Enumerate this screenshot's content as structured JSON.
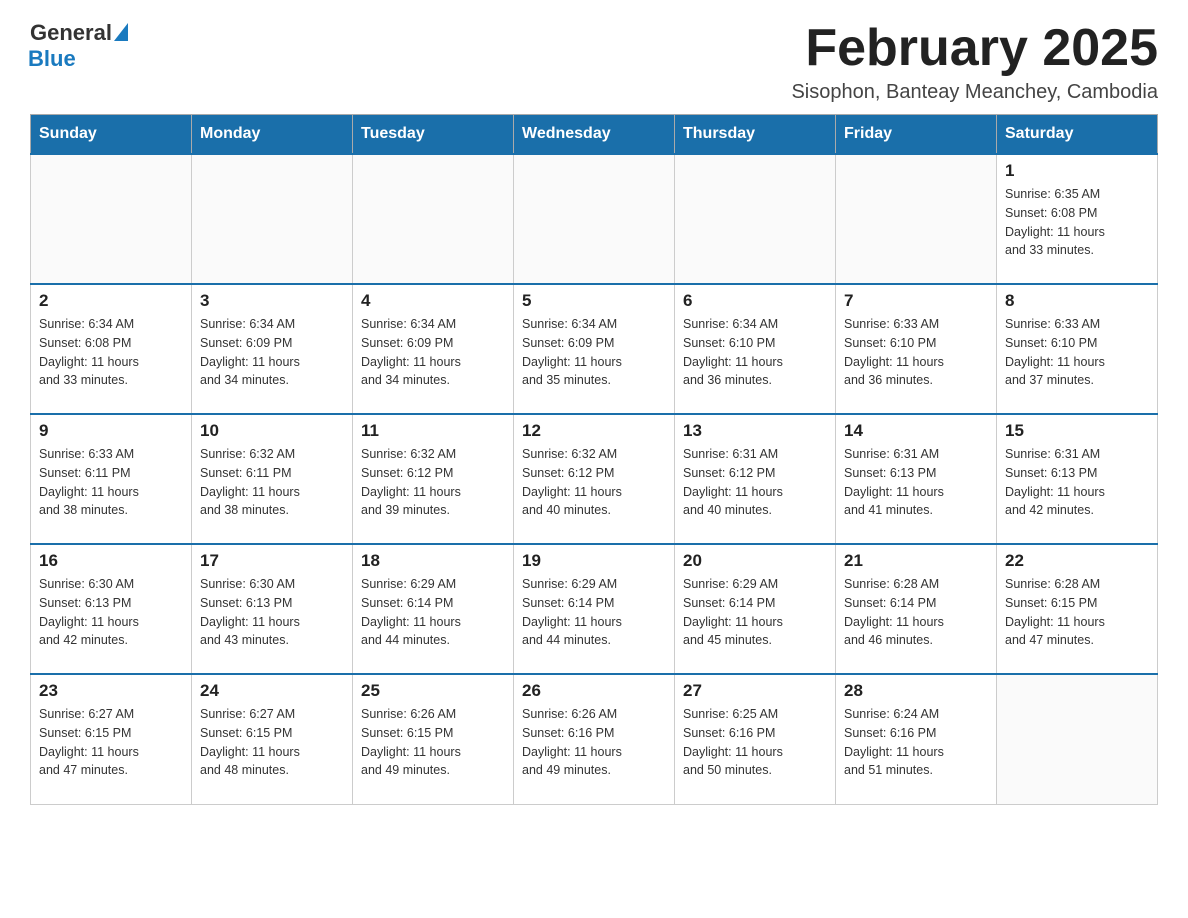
{
  "logo": {
    "general": "General",
    "blue": "Blue"
  },
  "header": {
    "title": "February 2025",
    "subtitle": "Sisophon, Banteay Meanchey, Cambodia"
  },
  "days_of_week": [
    "Sunday",
    "Monday",
    "Tuesday",
    "Wednesday",
    "Thursday",
    "Friday",
    "Saturday"
  ],
  "weeks": [
    [
      {
        "day": "",
        "info": ""
      },
      {
        "day": "",
        "info": ""
      },
      {
        "day": "",
        "info": ""
      },
      {
        "day": "",
        "info": ""
      },
      {
        "day": "",
        "info": ""
      },
      {
        "day": "",
        "info": ""
      },
      {
        "day": "1",
        "info": "Sunrise: 6:35 AM\nSunset: 6:08 PM\nDaylight: 11 hours\nand 33 minutes."
      }
    ],
    [
      {
        "day": "2",
        "info": "Sunrise: 6:34 AM\nSunset: 6:08 PM\nDaylight: 11 hours\nand 33 minutes."
      },
      {
        "day": "3",
        "info": "Sunrise: 6:34 AM\nSunset: 6:09 PM\nDaylight: 11 hours\nand 34 minutes."
      },
      {
        "day": "4",
        "info": "Sunrise: 6:34 AM\nSunset: 6:09 PM\nDaylight: 11 hours\nand 34 minutes."
      },
      {
        "day": "5",
        "info": "Sunrise: 6:34 AM\nSunset: 6:09 PM\nDaylight: 11 hours\nand 35 minutes."
      },
      {
        "day": "6",
        "info": "Sunrise: 6:34 AM\nSunset: 6:10 PM\nDaylight: 11 hours\nand 36 minutes."
      },
      {
        "day": "7",
        "info": "Sunrise: 6:33 AM\nSunset: 6:10 PM\nDaylight: 11 hours\nand 36 minutes."
      },
      {
        "day": "8",
        "info": "Sunrise: 6:33 AM\nSunset: 6:10 PM\nDaylight: 11 hours\nand 37 minutes."
      }
    ],
    [
      {
        "day": "9",
        "info": "Sunrise: 6:33 AM\nSunset: 6:11 PM\nDaylight: 11 hours\nand 38 minutes."
      },
      {
        "day": "10",
        "info": "Sunrise: 6:32 AM\nSunset: 6:11 PM\nDaylight: 11 hours\nand 38 minutes."
      },
      {
        "day": "11",
        "info": "Sunrise: 6:32 AM\nSunset: 6:12 PM\nDaylight: 11 hours\nand 39 minutes."
      },
      {
        "day": "12",
        "info": "Sunrise: 6:32 AM\nSunset: 6:12 PM\nDaylight: 11 hours\nand 40 minutes."
      },
      {
        "day": "13",
        "info": "Sunrise: 6:31 AM\nSunset: 6:12 PM\nDaylight: 11 hours\nand 40 minutes."
      },
      {
        "day": "14",
        "info": "Sunrise: 6:31 AM\nSunset: 6:13 PM\nDaylight: 11 hours\nand 41 minutes."
      },
      {
        "day": "15",
        "info": "Sunrise: 6:31 AM\nSunset: 6:13 PM\nDaylight: 11 hours\nand 42 minutes."
      }
    ],
    [
      {
        "day": "16",
        "info": "Sunrise: 6:30 AM\nSunset: 6:13 PM\nDaylight: 11 hours\nand 42 minutes."
      },
      {
        "day": "17",
        "info": "Sunrise: 6:30 AM\nSunset: 6:13 PM\nDaylight: 11 hours\nand 43 minutes."
      },
      {
        "day": "18",
        "info": "Sunrise: 6:29 AM\nSunset: 6:14 PM\nDaylight: 11 hours\nand 44 minutes."
      },
      {
        "day": "19",
        "info": "Sunrise: 6:29 AM\nSunset: 6:14 PM\nDaylight: 11 hours\nand 44 minutes."
      },
      {
        "day": "20",
        "info": "Sunrise: 6:29 AM\nSunset: 6:14 PM\nDaylight: 11 hours\nand 45 minutes."
      },
      {
        "day": "21",
        "info": "Sunrise: 6:28 AM\nSunset: 6:14 PM\nDaylight: 11 hours\nand 46 minutes."
      },
      {
        "day": "22",
        "info": "Sunrise: 6:28 AM\nSunset: 6:15 PM\nDaylight: 11 hours\nand 47 minutes."
      }
    ],
    [
      {
        "day": "23",
        "info": "Sunrise: 6:27 AM\nSunset: 6:15 PM\nDaylight: 11 hours\nand 47 minutes."
      },
      {
        "day": "24",
        "info": "Sunrise: 6:27 AM\nSunset: 6:15 PM\nDaylight: 11 hours\nand 48 minutes."
      },
      {
        "day": "25",
        "info": "Sunrise: 6:26 AM\nSunset: 6:15 PM\nDaylight: 11 hours\nand 49 minutes."
      },
      {
        "day": "26",
        "info": "Sunrise: 6:26 AM\nSunset: 6:16 PM\nDaylight: 11 hours\nand 49 minutes."
      },
      {
        "day": "27",
        "info": "Sunrise: 6:25 AM\nSunset: 6:16 PM\nDaylight: 11 hours\nand 50 minutes."
      },
      {
        "day": "28",
        "info": "Sunrise: 6:24 AM\nSunset: 6:16 PM\nDaylight: 11 hours\nand 51 minutes."
      },
      {
        "day": "",
        "info": ""
      }
    ]
  ]
}
